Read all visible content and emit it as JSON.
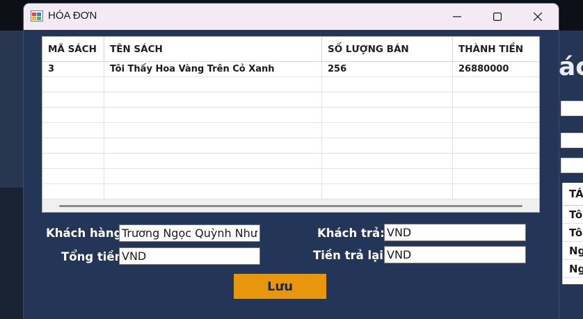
{
  "window": {
    "title": "HÓA ĐƠN"
  },
  "grid": {
    "columns": [
      "MÃ SÁCH",
      "TÊN SÁCH",
      "SỐ LƯỢNG BÁN",
      "THÀNH TIỀN"
    ],
    "rows": [
      {
        "ma_sach": "3",
        "ten_sach": "Tôi Thấy Hoa Vàng Trên Cỏ Xanh",
        "truncation": "...",
        "so_luong_ban": "256",
        "thanh_tien": "26880000"
      }
    ]
  },
  "form": {
    "customer_label": "Khách hàng:",
    "customer_value": "Trương Ngọc Quỳnh Như",
    "total_label": "Tổng tiền:",
    "total_value": "VND",
    "paid_label": "Khách trả:",
    "paid_value": "VND",
    "change_label": "Tiền trả lại:",
    "change_value": "VND",
    "save_label": "Lưu"
  },
  "background": {
    "title_fragment": "ác",
    "table_cells": [
      "TÁ",
      "Tô",
      "Tô",
      "Ng",
      "Ng"
    ]
  },
  "colors": {
    "window_bg": "#233658",
    "titlebar_bg": "#f3eaf3",
    "save_button": "#e8960b"
  }
}
